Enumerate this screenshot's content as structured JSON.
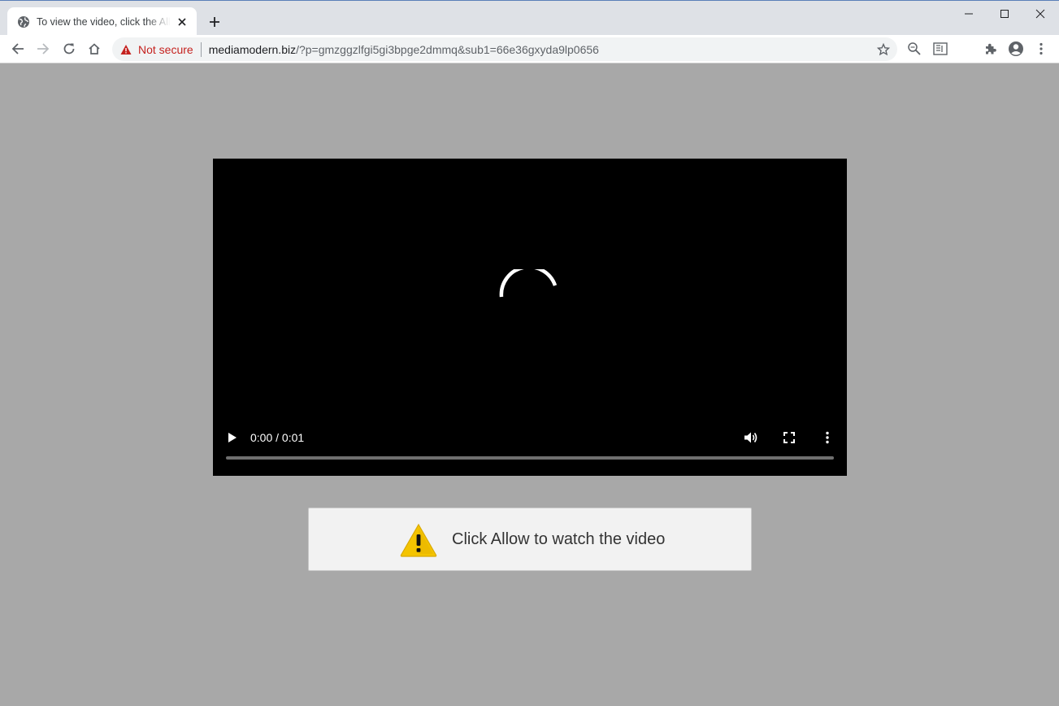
{
  "browser": {
    "tab": {
      "title": "To view the video, click the Allow button"
    },
    "omnibox": {
      "security_label": "Not secure",
      "url_host": "mediamodern.biz",
      "url_path": "/?p=gmzggzlfgi5gi3bpge2dmmq&sub1=66e36gxyda9lp0656"
    },
    "colors": {
      "tab_strip": "#dee1e6",
      "toolbar": "#ffffff",
      "omnibox": "#f1f3f4",
      "insecure": "#c5221f"
    },
    "icons": [
      "globe-icon",
      "close-icon",
      "plus-icon",
      "minimize-icon",
      "maximize-icon",
      "close-window-icon",
      "back-icon",
      "forward-icon",
      "reload-icon",
      "home-icon",
      "warning-icon",
      "star-icon",
      "zoom-icon",
      "reading-list-icon",
      "extensions-icon",
      "profile-icon",
      "kebab-menu-icon"
    ]
  },
  "page": {
    "background": "#a8a8a8",
    "video": {
      "time": "0:00 / 0:01",
      "progress": 0.0,
      "icons": [
        "spinner-icon",
        "play-icon",
        "volume-icon",
        "fullscreen-icon",
        "more-options-icon"
      ]
    },
    "banner": {
      "message": "Click Allow to watch the video",
      "icon": "warning-icon",
      "icon_color": "#f4c400"
    }
  }
}
